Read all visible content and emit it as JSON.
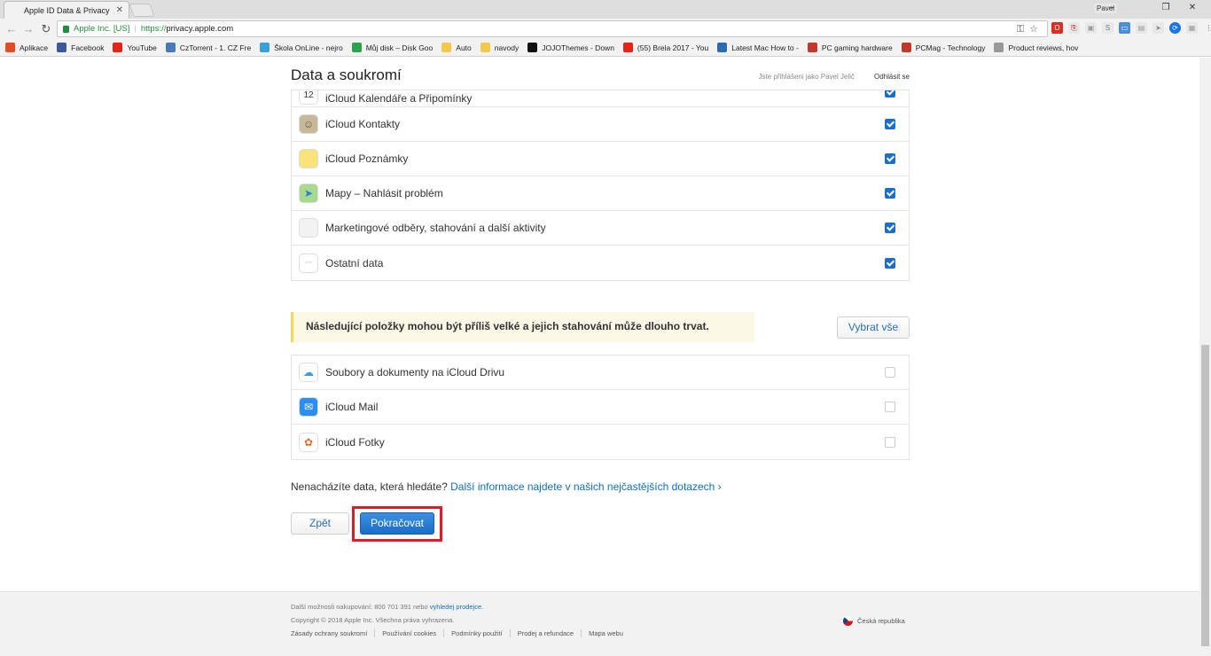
{
  "browser": {
    "tab_title": "Apple ID Data & Privacy",
    "tab_close": "✕",
    "user": "Pavel",
    "secure_org": "Apple Inc. [US]",
    "url_scheme": "https://",
    "url_host": "privacy.apple.com",
    "bookmarks": [
      {
        "label": "Aplikace",
        "icon": "apps-grid-icon",
        "color": "#e34c26"
      },
      {
        "label": "Facebook",
        "icon": "facebook-icon",
        "color": "#3b5998"
      },
      {
        "label": "YouTube",
        "icon": "youtube-icon",
        "color": "#e62117"
      },
      {
        "label": "CzTorrent - 1. CZ Fre",
        "icon": "cztorrent-icon",
        "color": "#4a7ab5"
      },
      {
        "label": "Škola OnLine - nejro",
        "icon": "skola-icon",
        "color": "#3aa0d8"
      },
      {
        "label": "Můj disk – Disk Goo",
        "icon": "google-drive-icon",
        "color": "#2ba24c"
      },
      {
        "label": "Auto",
        "icon": "folder-icon",
        "color": "#f2c94c"
      },
      {
        "label": "navody",
        "icon": "folder-icon",
        "color": "#f2c94c"
      },
      {
        "label": "JOJOThemes - Down",
        "icon": "jojo-icon",
        "color": "#111111"
      },
      {
        "label": "(55) Brela 2017 - You",
        "icon": "youtube-icon",
        "color": "#e62117"
      },
      {
        "label": "Latest Mac How to -",
        "icon": "mac-icon",
        "color": "#2b6cb0"
      },
      {
        "label": "PC gaming hardware",
        "icon": "pcgamer-icon",
        "color": "#c0392b"
      },
      {
        "label": "PCMag - Technology",
        "icon": "pcmag-icon",
        "color": "#c0392b"
      },
      {
        "label": "Product reviews, hov",
        "icon": "page-icon",
        "color": "#999999"
      }
    ]
  },
  "header": {
    "title": "Data a soukromí",
    "signed_in": "Jste přihlášeni jako Pavel Jelič",
    "sign_out": "Odhlásit se"
  },
  "list1": [
    {
      "label": "iCloud Kalendáře a Připomínky",
      "icon": "calendar-icon",
      "checked": true
    },
    {
      "label": "iCloud Kontakty",
      "icon": "contacts-icon",
      "checked": true
    },
    {
      "label": "iCloud Poznámky",
      "icon": "notes-icon",
      "checked": true
    },
    {
      "label": "Mapy – Nahlásit problém",
      "icon": "maps-icon",
      "checked": true
    },
    {
      "label": "Marketingové odběry, stahování a další aktivity",
      "icon": "apple-icon",
      "checked": true
    },
    {
      "label": "Ostatní data",
      "icon": "ellipsis-icon",
      "checked": true
    }
  ],
  "notice": "Následující položky mohou být příliš velké a jejich stahování může dlouho trvat.",
  "select_all": "Vybrat vše",
  "list2": [
    {
      "label": "Soubory a dokumenty na iCloud Drivu",
      "icon": "icloud-drive-icon",
      "checked": false
    },
    {
      "label": "iCloud Mail",
      "icon": "mail-icon",
      "checked": false
    },
    {
      "label": "iCloud Fotky",
      "icon": "photos-icon",
      "checked": false
    }
  ],
  "faq": {
    "text": "Nenacházíte data, která hledáte?",
    "link": "Další informace najdete v našich nejčastějších dotazech ›"
  },
  "buttons": {
    "back": "Zpět",
    "continue": "Pokračovat"
  },
  "footer": {
    "shop_text": "Další možnosti nakupování: 800 701 391 nebo",
    "shop_link": "vyhledej prodejce",
    "shop_end": ".",
    "copyright": "Copyright © 2018 Apple Inc. Všechna práva vyhrazena.",
    "links": [
      "Zásady ochrany soukromí",
      "Používání cookies",
      "Podmínky použití",
      "Prodej a refundace",
      "Mapa webu"
    ],
    "region": "Česká republika"
  }
}
